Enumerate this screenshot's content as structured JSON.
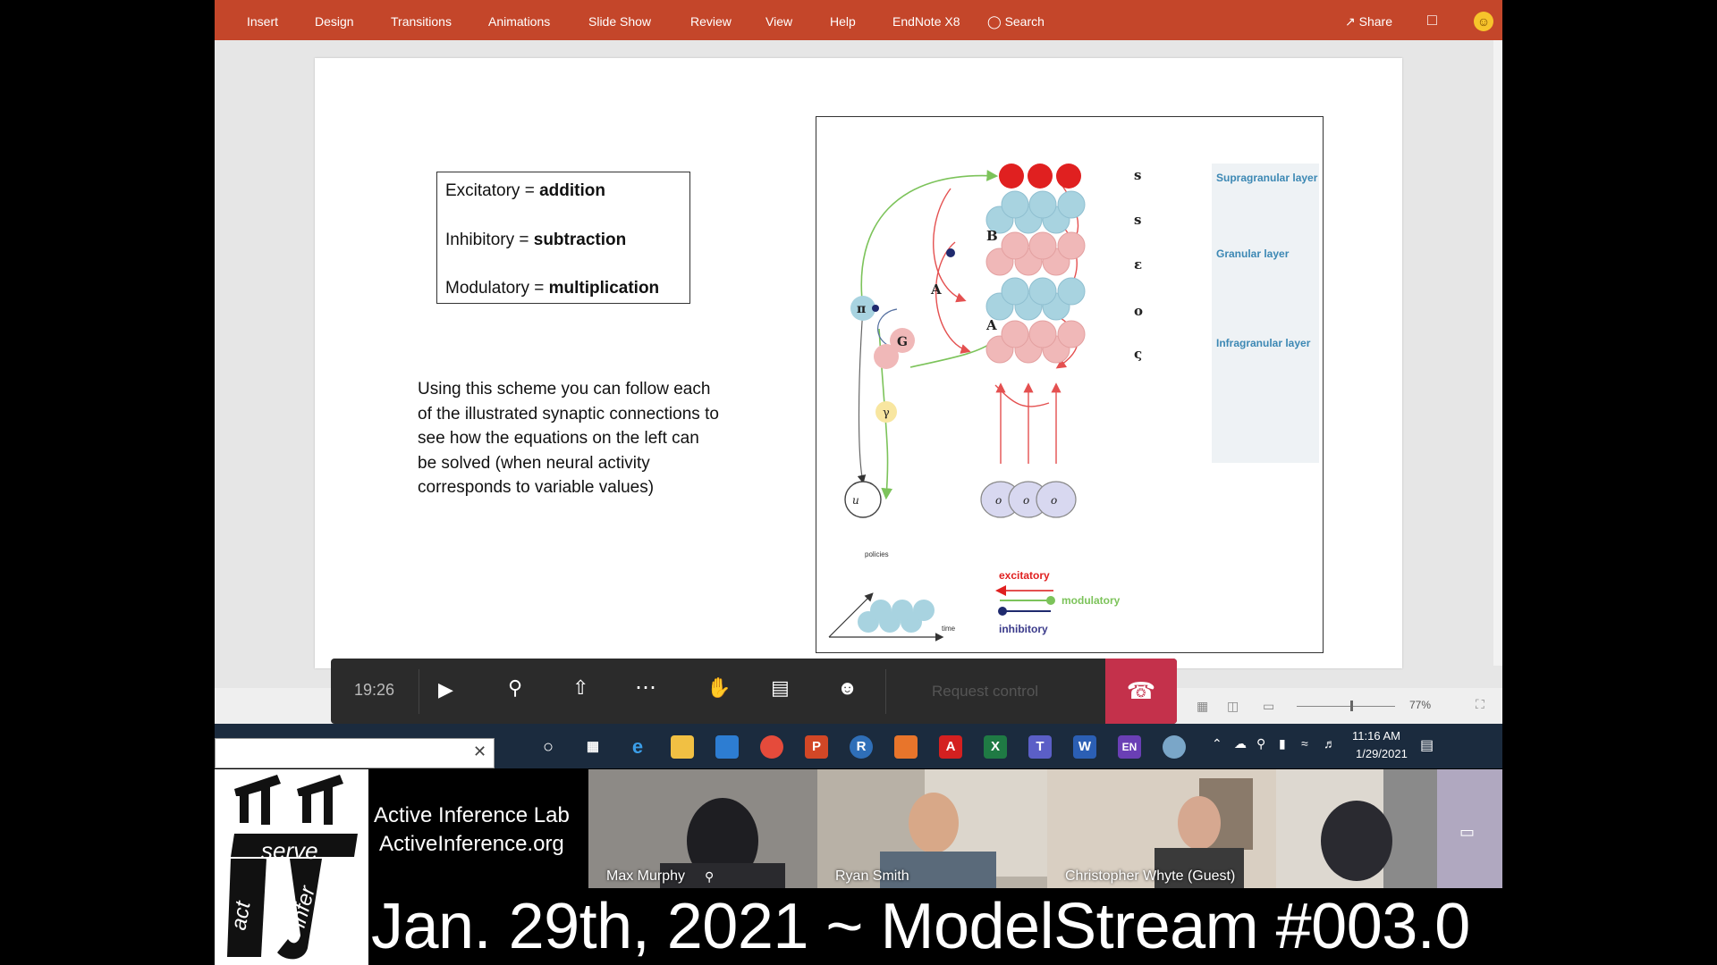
{
  "ribbon": {
    "tabs": [
      "Insert",
      "Design",
      "Transitions",
      "Animations",
      "Slide Show",
      "Review",
      "View",
      "Help",
      "EndNote X8"
    ],
    "search_label": "Search",
    "share_label": "Share"
  },
  "slide": {
    "definitions": [
      {
        "term": "Excitatory = ",
        "op": "addition"
      },
      {
        "term": "Inhibitory = ",
        "op": "subtraction"
      },
      {
        "term": "Modulatory = ",
        "op": "multiplication"
      }
    ],
    "scheme_text": "Using this scheme you can follow each of the illustrated synaptic connections to see how the equations on the left can be solved (when neural activity corresponds to variable values)",
    "figure": {
      "layers": [
        "Supragranular layer",
        "Granular layer",
        "Infragranular layer"
      ],
      "legend": {
        "excitatory": "excitatory",
        "modulatory": "modulatory",
        "inhibitory": "inhibitory",
        "policies": "policies",
        "time": "time"
      }
    }
  },
  "teams": {
    "timer": "19:26",
    "request_control": "Request control"
  },
  "status": {
    "zoom": "77%"
  },
  "taskbar": {
    "time": "11:16 AM",
    "date": "1/29/2021",
    "lang": "EN"
  },
  "stream": {
    "lab_name": "Active Inference Lab",
    "lab_url": "ActiveInference.org",
    "logo_words": {
      "serve": "serve",
      "act": "act",
      "infer": "infer"
    },
    "participants": [
      "Max Murphy",
      "Ryan Smith",
      "Christopher Whyte (Guest)"
    ],
    "caption": "Jan. 29th, 2021 ~ ModelStream #003.0"
  },
  "colors": {
    "ribbon": "#c4462a",
    "end_call": "#c4314b",
    "accent_blue": "#3c88b4"
  }
}
